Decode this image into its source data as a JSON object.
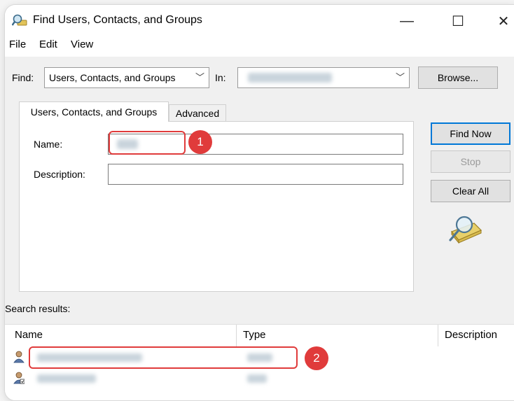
{
  "window": {
    "title": "Find Users, Contacts, and Groups",
    "controls": {
      "minimize": "—",
      "maximize": "☐",
      "close": "✕"
    }
  },
  "menu": [
    "File",
    "Edit",
    "View"
  ],
  "find_bar": {
    "find_label": "Find:",
    "find_value": "Users, Contacts, and Groups",
    "in_label": "In:",
    "browse_label": "Browse..."
  },
  "tabs": [
    {
      "label": "Users, Contacts, and Groups",
      "active": true
    },
    {
      "label": "Advanced",
      "active": false
    }
  ],
  "fields": {
    "name_label": "Name:",
    "description_label": "Description:"
  },
  "buttons": {
    "find_now": "Find Now",
    "stop": "Stop",
    "clear_all": "Clear All"
  },
  "search_results_label": "Search results:",
  "columns": [
    "Name",
    "Type",
    "Description"
  ],
  "annotations": {
    "badge_1": "1",
    "badge_2": "2"
  },
  "colors": {
    "callout": "#e03b3b",
    "accent": "#0078d7"
  },
  "icons": {
    "app": "search-magnifier-icon",
    "search_graphic": "magnifier-over-book-icon",
    "user": "user-icon"
  }
}
